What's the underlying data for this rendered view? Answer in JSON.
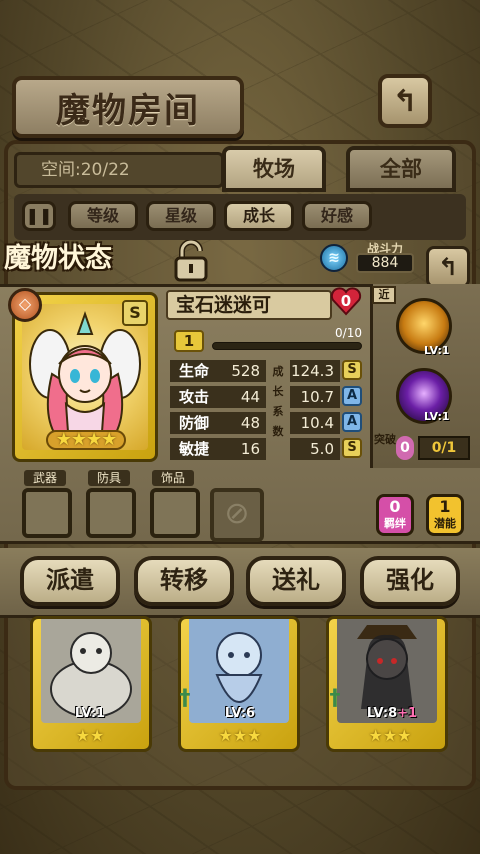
{
  "header": {
    "title": "魔物房间",
    "back_icon": "return-arrow-icon"
  },
  "space": {
    "label": "空间:20/22"
  },
  "tabs": [
    {
      "label": "牧场",
      "selected": true
    },
    {
      "label": "全部",
      "selected": false
    }
  ],
  "filters": [
    {
      "label": "等级",
      "selected": false
    },
    {
      "label": "星级",
      "selected": false
    },
    {
      "label": "成长",
      "selected": true
    },
    {
      "label": "好感",
      "selected": false
    }
  ],
  "status": {
    "title": "魔物状态",
    "power_label": "战斗力",
    "power_value": "884",
    "name": "宝石迷迷可",
    "affection": "0",
    "level": "1",
    "xp_text": "0/10",
    "xp_fraction": 0,
    "card_rank": "S",
    "card_stars": "★★★★",
    "stats": [
      {
        "label": "生命",
        "value": "528",
        "growth": "124.3",
        "grade": "S"
      },
      {
        "label": "攻击",
        "value": "44",
        "growth": "10.7",
        "grade": "A"
      },
      {
        "label": "防御",
        "value": "48",
        "growth": "10.4",
        "grade": "A"
      },
      {
        "label": "敏捷",
        "value": "16",
        "growth": "5.0",
        "grade": "S"
      }
    ],
    "growth_vertical": "成长系数"
  },
  "skills": {
    "range_tag": "近",
    "items": [
      {
        "level": "LV:1"
      },
      {
        "level": "LV:1"
      }
    ],
    "break_label": "突破",
    "break_count": "0",
    "break_value": "0/1"
  },
  "equipment": {
    "slots": [
      "武器",
      "防具",
      "饰品"
    ]
  },
  "badges": [
    {
      "value": "0",
      "label": "羁绊",
      "color": "#d54fa8"
    },
    {
      "value": "1",
      "label": "潜能",
      "color": "#f2c22e"
    }
  ],
  "actions": [
    "派遣",
    "转移",
    "送礼",
    "强化"
  ],
  "monsters": [
    {
      "level": "LV:1",
      "stars": "★★",
      "plus": ""
    },
    {
      "level": "LV:6",
      "stars": "★★★",
      "plus": ""
    },
    {
      "level": "LV:8",
      "stars": "★★★",
      "plus": "+1"
    }
  ]
}
